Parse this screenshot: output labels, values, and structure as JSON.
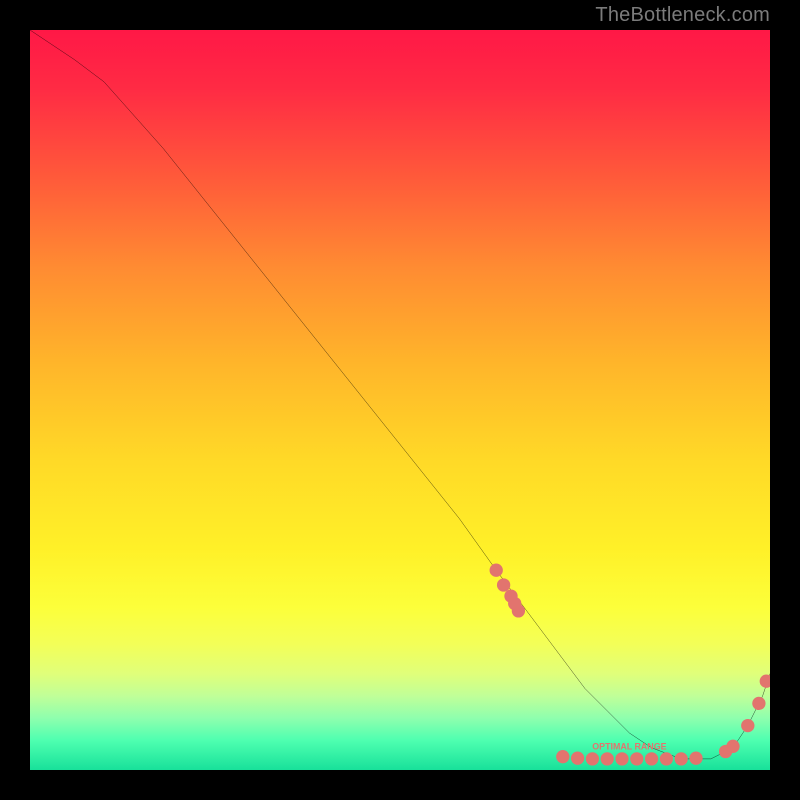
{
  "watermark": "TheBottleneck.com",
  "chart_data": {
    "type": "line",
    "title": "",
    "xlabel": "",
    "ylabel": "",
    "xlim": [
      0,
      100
    ],
    "ylim": [
      0,
      100
    ],
    "grid": false,
    "series": [
      {
        "name": "curve",
        "x": [
          0,
          6,
          10,
          18,
          26,
          34,
          42,
          50,
          58,
          63,
          66,
          69,
          72,
          75,
          78,
          81,
          84,
          88,
          92,
          95,
          97,
          99,
          100
        ],
        "y": [
          100,
          96,
          93,
          84,
          74,
          64,
          54,
          44,
          34,
          27,
          23,
          19,
          15,
          11,
          8,
          5,
          3,
          1.5,
          1.5,
          3,
          6,
          10,
          13
        ]
      }
    ],
    "clusters": [
      {
        "name": "left-cluster",
        "x": [
          63,
          64,
          65,
          65.5,
          66
        ],
        "y": [
          27,
          25,
          23.5,
          22.5,
          21.5
        ]
      },
      {
        "name": "floor-cluster",
        "x": [
          72,
          74,
          76,
          78,
          80,
          82,
          84,
          86,
          88,
          90
        ],
        "y": [
          1.8,
          1.6,
          1.5,
          1.5,
          1.5,
          1.5,
          1.5,
          1.5,
          1.5,
          1.6
        ]
      },
      {
        "name": "right-cluster",
        "x": [
          94,
          95,
          97,
          98.5,
          99.5
        ],
        "y": [
          2.5,
          3.2,
          6,
          9,
          12
        ]
      }
    ],
    "floor_label": {
      "text": "OPTIMAL RANGE",
      "x": 81,
      "y": 2.8
    },
    "marker_color": "#e2746e",
    "line_color": "#000000"
  }
}
